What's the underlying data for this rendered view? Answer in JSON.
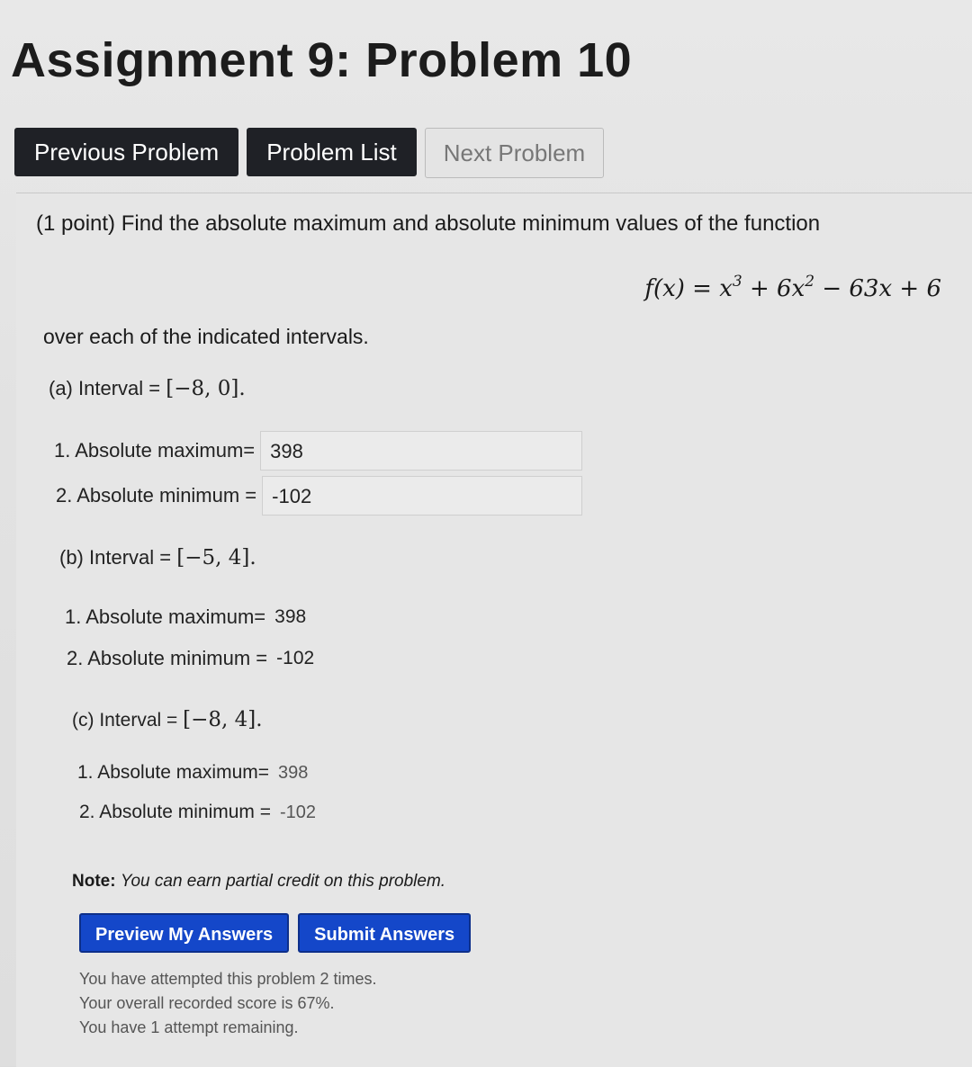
{
  "header": {
    "title": "Assignment 9: Problem 10"
  },
  "nav": {
    "previous_label": "Previous Problem",
    "list_label": "Problem List",
    "next_label": "Next Problem"
  },
  "problem": {
    "statement": "(1 point) Find the absolute maximum and absolute minimum values of the function",
    "formula": {
      "lhs": "f(x) = x",
      "exp1": "3",
      "mid": "+ 6x",
      "exp2": "2",
      "rest": "− 63x + 6"
    },
    "over_text": "over each of the indicated intervals.",
    "parts": [
      {
        "interval_label": "(a) Interval = ",
        "interval_math": "[−8, 0].",
        "max_label": "1. Absolute maximum=",
        "max_value": "398",
        "min_label": "2. Absolute minimum =",
        "min_value": "-102"
      },
      {
        "interval_label": "(b) Interval = ",
        "interval_math": "[−5, 4].",
        "max_label": "1. Absolute maximum=",
        "max_value": "398",
        "min_label": "2. Absolute minimum =",
        "min_value": "-102"
      },
      {
        "interval_label": "(c) Interval = ",
        "interval_math": "[−8, 4].",
        "max_label": "1. Absolute maximum=",
        "max_value": "398",
        "min_label": "2. Absolute minimum =",
        "min_value": "-102"
      }
    ],
    "note_label": "Note:",
    "note_text": "You can earn partial credit on this problem."
  },
  "actions": {
    "preview_label": "Preview My Answers",
    "submit_label": "Submit Answers"
  },
  "status": {
    "attempts": "You have attempted this problem 2 times.",
    "score": "Your overall recorded score is 67%.",
    "remaining": "You have 1 attempt remaining."
  }
}
